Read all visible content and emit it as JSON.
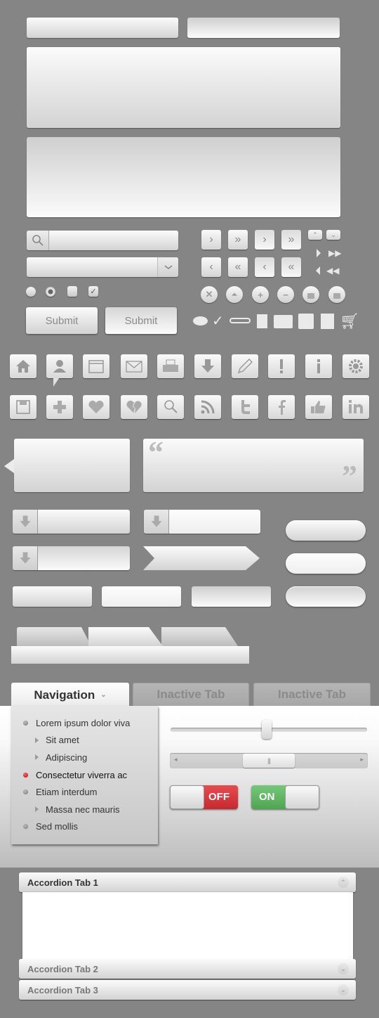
{
  "colors": {
    "background": "#858585",
    "toggle_off": "#d6343a",
    "toggle_on": "#5cb85c",
    "active_bullet": "#cc1111"
  },
  "forms": {
    "search": {
      "icon": "search-icon",
      "value": "",
      "placeholder": ""
    },
    "select": {
      "selected": "",
      "icon": "chevron-down-icon"
    },
    "submit_primary": "Submit",
    "submit_secondary": "Submit"
  },
  "small_controls": {
    "pagination": [
      {
        "icon": "chevron-right-icon",
        "glyph": "›"
      },
      {
        "icon": "double-chevron-right-icon",
        "glyph": "»"
      },
      {
        "icon": "chevron-right-icon",
        "glyph": "›"
      },
      {
        "icon": "double-chevron-right-icon",
        "glyph": "»"
      },
      {
        "icon": "chevron-left-icon",
        "glyph": "‹"
      },
      {
        "icon": "double-chevron-left-icon",
        "glyph": "«"
      },
      {
        "icon": "chevron-left-icon",
        "glyph": "‹"
      },
      {
        "icon": "double-chevron-left-icon",
        "glyph": "«"
      }
    ],
    "mini": [
      {
        "icon": "caret-up-icon",
        "glyph": "⌃"
      },
      {
        "icon": "caret-down-icon",
        "glyph": "⌄"
      }
    ],
    "circles": [
      {
        "icon": "close-icon",
        "glyph": "✕"
      },
      {
        "icon": "eject-icon",
        "glyph": "⏶"
      },
      {
        "icon": "plus-icon",
        "glyph": "+"
      },
      {
        "icon": "minus-icon",
        "glyph": "−"
      },
      {
        "icon": "lock-icon",
        "glyph": "🔒"
      },
      {
        "icon": "unlock-icon",
        "glyph": "🔓"
      }
    ]
  },
  "icon_tiles": {
    "row1": [
      "home-icon",
      "user-icon",
      "calendar-icon",
      "mail-icon",
      "printer-icon",
      "download-icon",
      "pencil-icon",
      "alert-icon",
      "info-icon",
      "gear-icon"
    ],
    "row2": [
      "save-icon",
      "plus-icon",
      "heart-icon",
      "broken-heart-icon",
      "search-icon",
      "rss-icon",
      "twitter-icon",
      "facebook-icon",
      "thumbs-up-icon",
      "linkedin-icon"
    ]
  },
  "quote": {
    "open": "“",
    "close": "”"
  },
  "nav_tabs": {
    "active": "Navigation",
    "inactive": [
      "Inactive Tab",
      "Inactive Tab"
    ]
  },
  "nav_menu": [
    {
      "label": "Lorem ipsum dolor viva",
      "level": 0,
      "active": false
    },
    {
      "label": "Sit amet",
      "level": 1,
      "active": false
    },
    {
      "label": "Adipiscing",
      "level": 1,
      "active": false
    },
    {
      "label": "Consectetur viverra ac",
      "level": 0,
      "active": true
    },
    {
      "label": "Etiam interdum",
      "level": 0,
      "active": false
    },
    {
      "label": "Massa nec mauris",
      "level": 1,
      "active": false
    },
    {
      "label": "Sed mollis",
      "level": 0,
      "active": false
    }
  ],
  "slider": {
    "value_percent": 49
  },
  "scrollbar": {
    "thumb_start_percent": 37,
    "thumb_size_percent": 26
  },
  "toggles": {
    "off_label": "OFF",
    "on_label": "ON"
  },
  "accordion": [
    {
      "label": "Accordion Tab 1",
      "expanded": true
    },
    {
      "label": "Accordion Tab 2",
      "expanded": false
    },
    {
      "label": "Accordion Tab 3",
      "expanded": false
    }
  ]
}
